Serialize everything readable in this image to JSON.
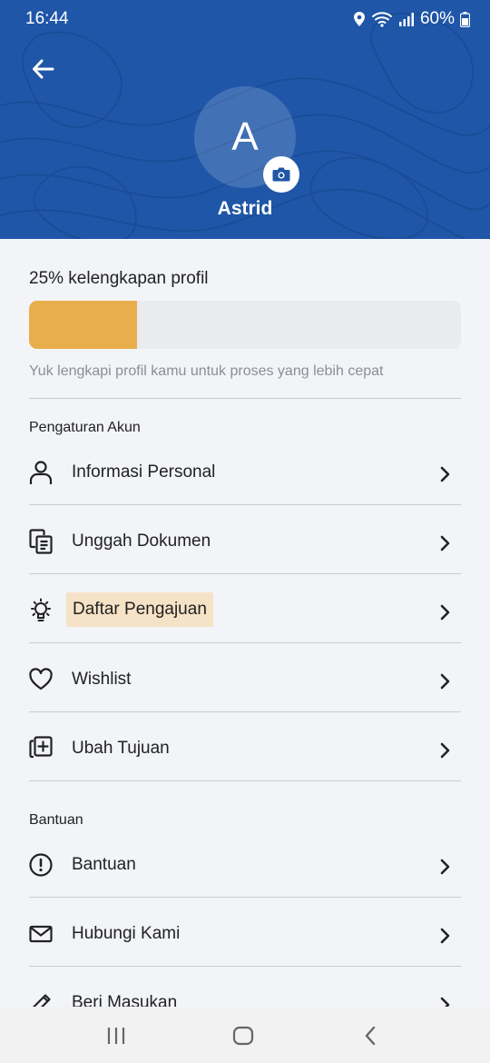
{
  "status_bar": {
    "time": "16:44",
    "battery": "60%"
  },
  "profile": {
    "initial": "A",
    "name": "Astrid"
  },
  "completion": {
    "label": "25% kelengkapan profil",
    "fraction": 0.25,
    "hint": "Yuk lengkapi profil kamu untuk proses yang lebih cepat"
  },
  "sections": {
    "account": {
      "title": "Pengaturan Akun",
      "items": [
        {
          "label": "Informasi Personal",
          "icon": "user-icon"
        },
        {
          "label": "Unggah Dokumen",
          "icon": "document-icon"
        },
        {
          "label": "Daftar Pengajuan",
          "icon": "lightbulb-icon"
        },
        {
          "label": "Wishlist",
          "icon": "heart-icon"
        },
        {
          "label": "Ubah Tujuan",
          "icon": "add-copy-icon"
        }
      ]
    },
    "help": {
      "title": "Bantuan",
      "items": [
        {
          "label": "Bantuan",
          "icon": "alert-circle-icon"
        },
        {
          "label": "Hubungi Kami",
          "icon": "mail-icon"
        },
        {
          "label": "Beri Masukan",
          "icon": "pencil-icon"
        }
      ]
    }
  },
  "colors": {
    "header": "#1f56a8",
    "progress": "#e9ae4c",
    "highlight": "#f6e2c6"
  }
}
